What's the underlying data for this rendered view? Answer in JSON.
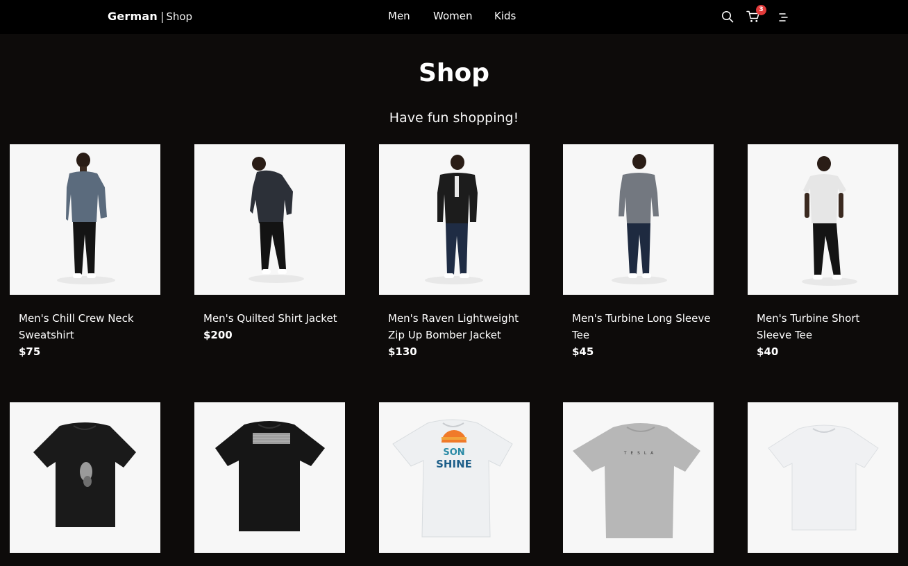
{
  "header": {
    "brand_main": "German",
    "brand_sep": "|",
    "brand_sub": "Shop",
    "nav": [
      {
        "label": "Men"
      },
      {
        "label": "Women"
      },
      {
        "label": "Kids"
      }
    ],
    "cart_count": "3",
    "icons": [
      "search-icon",
      "cart-icon",
      "menu-icon"
    ]
  },
  "hero": {
    "title": "Shop",
    "subtitle": "Have fun shopping!"
  },
  "products": [
    {
      "name": "Men's Chill Crew Neck Sweatshirt",
      "price": "$75",
      "image": "model-blue-sweatshirt"
    },
    {
      "name": "Men's Quilted Shirt Jacket",
      "price": "$200",
      "image": "model-black-quilted-jacket"
    },
    {
      "name": "Men's Raven Lightweight Zip Up Bomber Jacket",
      "price": "$130",
      "image": "model-black-bomber-jacket"
    },
    {
      "name": "Men's Turbine Long Sleeve Tee",
      "price": "$45",
      "image": "model-grey-long-sleeve"
    },
    {
      "name": "Men's Turbine Short Sleeve Tee",
      "price": "$40",
      "image": "model-white-tee"
    },
    {
      "name": "",
      "price": "",
      "image": "black-tee-owl-graphic"
    },
    {
      "name": "",
      "price": "",
      "image": "black-tee-banner-graphic"
    },
    {
      "name": "",
      "price": "",
      "image": "white-tee-sunshine-graphic",
      "graphic_text": [
        "SON",
        "SHINE"
      ]
    },
    {
      "name": "",
      "price": "",
      "image": "grey-tee-tesla-wordmark",
      "graphic_text": [
        "T E S L A"
      ]
    },
    {
      "name": "",
      "price": "",
      "image": "white-tee-plain"
    }
  ],
  "colors": {
    "background": "#0d0b0a",
    "header": "#000000",
    "badge": "#e23a3a",
    "card": "#f7f7f7"
  }
}
